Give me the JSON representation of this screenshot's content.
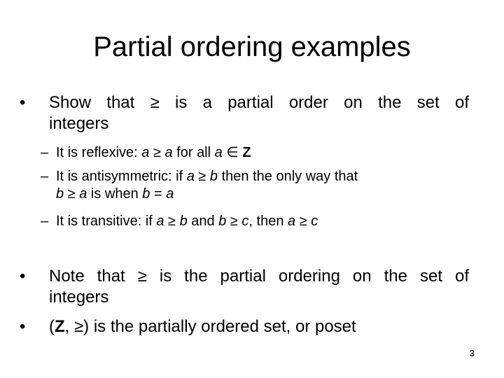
{
  "slide": {
    "title": "Partial ordering examples",
    "bullet_glyph": "•",
    "dash_glyph": "–",
    "bullets": [
      {
        "line1": "Show that ≥ is a partial order on the set of",
        "line2": "integers",
        "subitems": [
          {
            "parts": [
              "It is reflexive: ",
              "a",
              " ≥ ",
              "a",
              " for all ",
              "a",
              " ∈ ",
              "Z"
            ]
          },
          {
            "line1_parts": [
              "It is antisymmetric: if ",
              "a",
              " ≥ ",
              "b",
              " then the only way that"
            ],
            "line2_parts": [
              "b",
              " ≥ ",
              "a",
              " is when ",
              "b",
              " = ",
              "a"
            ]
          },
          {
            "parts": [
              "It is transitive: if ",
              "a",
              " ≥ ",
              "b",
              " and ",
              "b",
              " ≥ ",
              "c",
              ", then ",
              "a",
              " ≥ ",
              "c"
            ]
          }
        ]
      },
      {
        "line1": "Note that ≥ is the partial ordering on the set of",
        "line2": "integers"
      },
      {
        "parts": [
          "(",
          "Z",
          ", ≥) is the partially ordered set, or poset"
        ]
      }
    ],
    "page_number": "3"
  }
}
